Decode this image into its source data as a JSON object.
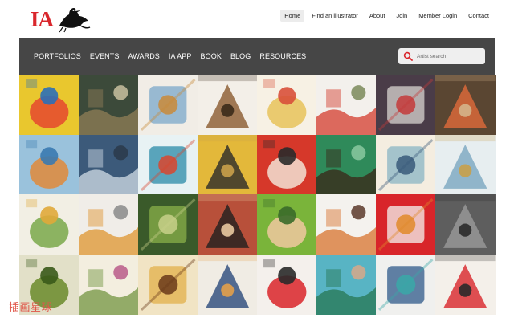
{
  "brand": {
    "logo_text": "IA"
  },
  "top_nav": {
    "items": [
      "Home",
      "Find an illustrator",
      "About",
      "Join",
      "Member Login",
      "Contact"
    ],
    "active": "Home"
  },
  "main_menu": {
    "items": [
      "PORTFOLIOS",
      "EVENTS",
      "AWARDS",
      "IA APP",
      "BOOK",
      "BLOG",
      "RESOURCES"
    ]
  },
  "search": {
    "placeholder": "Artist search"
  },
  "gallery": {
    "columns": 8,
    "rows": 4,
    "tiles": [
      {
        "bg": "#e9c72e",
        "fg": "#e5482e",
        "accent": "#2b6fb8"
      },
      {
        "bg": "#3c4a3a",
        "fg": "#8b7a55",
        "accent": "#c8c0a0"
      },
      {
        "bg": "#f1ede6",
        "fg": "#7aa7c9",
        "accent": "#c98a3a"
      },
      {
        "bg": "#f3efe8",
        "fg": "#8a5a2e",
        "accent": "#3a2a1a"
      },
      {
        "bg": "#f7f1e4",
        "fg": "#e8c35a",
        "accent": "#d8503a"
      },
      {
        "bg": "#f3f0ec",
        "fg": "#d6473a",
        "accent": "#7a8a5a"
      },
      {
        "bg": "#4a3c48",
        "fg": "#d9d4d0",
        "accent": "#c43a3a"
      },
      {
        "bg": "#5a4632",
        "fg": "#e06a3a",
        "accent": "#d4b48a"
      },
      {
        "bg": "#9ac2dc",
        "fg": "#e08a3a",
        "accent": "#3a7ab0"
      },
      {
        "bg": "#3c5a7a",
        "fg": "#c8d4e0",
        "accent": "#2a3a4a"
      },
      {
        "bg": "#e8f2f4",
        "fg": "#2a8aa8",
        "accent": "#d9462e"
      },
      {
        "bg": "#e3b83a",
        "fg": "#2a2a2a",
        "accent": "#c9a04a"
      },
      {
        "bg": "#d6382a",
        "fg": "#f2e2d4",
        "accent": "#2a2a2a"
      },
      {
        "bg": "#2f8a5a",
        "fg": "#3a2a1a",
        "accent": "#8ac8a0"
      },
      {
        "bg": "#f4ede0",
        "fg": "#8ab4c4",
        "accent": "#3a5a7a"
      },
      {
        "bg": "#e7eef0",
        "fg": "#7aa6c0",
        "accent": "#c8a04a"
      },
      {
        "bg": "#f2efe4",
        "fg": "#7aa84a",
        "accent": "#e0a83a"
      },
      {
        "bg": "#f0ede8",
        "fg": "#e09a3a",
        "accent": "#8a8a8a"
      },
      {
        "bg": "#3a5a2a",
        "fg": "#8ab04a",
        "accent": "#c8d08a"
      },
      {
        "bg": "#b8503a",
        "fg": "#1f1f1f",
        "accent": "#e8c8a0"
      },
      {
        "bg": "#7ab43a",
        "fg": "#f0c8a0",
        "accent": "#3a6a2a"
      },
      {
        "bg": "#f4f2ee",
        "fg": "#d97a3a",
        "accent": "#5a3a2a"
      },
      {
        "bg": "#d8252a",
        "fg": "#f4f4f0",
        "accent": "#e08a2a"
      },
      {
        "bg": "#5e5e5e",
        "fg": "#9a9a9a",
        "accent": "#2a2a2a"
      },
      {
        "bg": "#e2e0c8",
        "fg": "#6a8a2a",
        "accent": "#3a5a1a"
      },
      {
        "bg": "#f3eedf",
        "fg": "#7a9a4a",
        "accent": "#b85a8a"
      },
      {
        "bg": "#f1e4c4",
        "fg": "#e2b04a",
        "accent": "#6a3a1a"
      },
      {
        "bg": "#f0ece4",
        "fg": "#2a4a7a",
        "accent": "#e2a04a"
      },
      {
        "bg": "#f4f0ec",
        "fg": "#d9252a",
        "accent": "#2a2a2a"
      },
      {
        "bg": "#58b4c4",
        "fg": "#2a7a5a",
        "accent": "#d8a88a"
      },
      {
        "bg": "#f0f0ee",
        "fg": "#2f5a8a",
        "accent": "#3aa8a8"
      },
      {
        "bg": "#f4f0ea",
        "fg": "#d8252a",
        "accent": "#2a2a2a"
      }
    ]
  },
  "watermark": {
    "text": "插画星球"
  }
}
